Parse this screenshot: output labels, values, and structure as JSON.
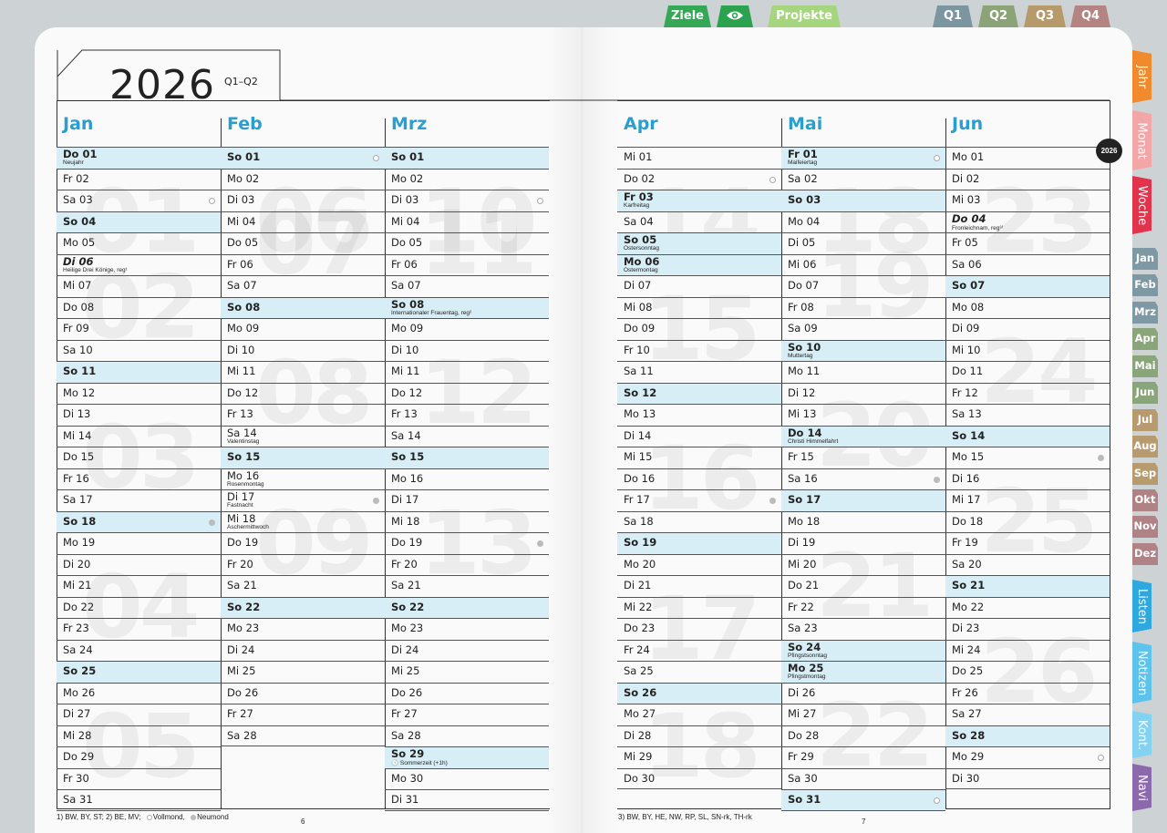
{
  "top_tabs": [
    {
      "label": "Ziele",
      "color": "#35a855"
    },
    {
      "label": "",
      "icon": "eye-icon",
      "color": "#2aa24e"
    },
    {
      "label": "Projekte",
      "color": "#a5d57c"
    },
    {
      "label": "Q1",
      "color": "#7b96a0"
    },
    {
      "label": "Q2",
      "color": "#8ba376"
    },
    {
      "label": "Q3",
      "color": "#b69a6a"
    },
    {
      "label": "Q4",
      "color": "#b38482"
    }
  ],
  "side_tabs": [
    {
      "label": "Jahr",
      "color": "#f08a2d"
    },
    {
      "label": "Monat",
      "color": "#f2a6a8"
    },
    {
      "label": "Woche",
      "color": "#e2334d"
    }
  ],
  "month_tabs": [
    {
      "label": "Jan",
      "color": "#7e98a4"
    },
    {
      "label": "Feb",
      "color": "#7e98a4"
    },
    {
      "label": "Mrz",
      "color": "#7e98a4"
    },
    {
      "label": "Apr",
      "color": "#8ba57a"
    },
    {
      "label": "Mai",
      "color": "#8ba57a"
    },
    {
      "label": "Jun",
      "color": "#8ba57a"
    },
    {
      "label": "Jul",
      "color": "#b79a6d"
    },
    {
      "label": "Aug",
      "color": "#b79a6d"
    },
    {
      "label": "Sep",
      "color": "#b79a6d"
    },
    {
      "label": "Okt",
      "color": "#b18285"
    },
    {
      "label": "Nov",
      "color": "#b18285"
    },
    {
      "label": "Dez",
      "color": "#b18285"
    }
  ],
  "bottom_tabs": [
    {
      "label": "Listen",
      "color": "#2ea8de"
    },
    {
      "label": "Notizen",
      "color": "#5ec3ec"
    },
    {
      "label": "Kont.",
      "color": "#83d2f2"
    },
    {
      "label": "Navi",
      "color": "#8c68ad"
    }
  ],
  "header": {
    "year": "2026",
    "quarter": "Q1–Q2",
    "badge": "2026"
  },
  "colors": {
    "month_heading": "#2a9fcf",
    "sunday_row": "#d8eef6"
  },
  "months": [
    {
      "name": "Jan",
      "weeks": [
        "01",
        "02",
        "03",
        "04",
        "05"
      ],
      "days": [
        {
          "t": "Do 01",
          "s": 1,
          "n": "Neujahr"
        },
        {
          "t": "Fr 02"
        },
        {
          "t": "Sa 03",
          "m": "full"
        },
        {
          "t": "So 04",
          "s": 1
        },
        {
          "t": "Mo 05"
        },
        {
          "t": "Di 06",
          "i": 1,
          "n": "Heilige Drei Könige, reg¹"
        },
        {
          "t": "Mi 07"
        },
        {
          "t": "Do 08"
        },
        {
          "t": "Fr 09"
        },
        {
          "t": "Sa 10"
        },
        {
          "t": "So 11",
          "s": 1
        },
        {
          "t": "Mo 12"
        },
        {
          "t": "Di 13"
        },
        {
          "t": "Mi 14"
        },
        {
          "t": "Do 15"
        },
        {
          "t": "Fr 16"
        },
        {
          "t": "Sa 17"
        },
        {
          "t": "So 18",
          "s": 1,
          "m": "new"
        },
        {
          "t": "Mo 19"
        },
        {
          "t": "Di 20"
        },
        {
          "t": "Mi 21"
        },
        {
          "t": "Do 22"
        },
        {
          "t": "Fr 23"
        },
        {
          "t": "Sa 24"
        },
        {
          "t": "So 25",
          "s": 1
        },
        {
          "t": "Mo 26"
        },
        {
          "t": "Di 27"
        },
        {
          "t": "Mi 28"
        },
        {
          "t": "Do 29"
        },
        {
          "t": "Fr 30"
        },
        {
          "t": "Sa 31"
        }
      ]
    },
    {
      "name": "Feb",
      "weeks": [
        "06",
        "07",
        "08",
        "09"
      ],
      "days": [
        {
          "t": "So 01",
          "s": 1,
          "m": "full"
        },
        {
          "t": "Mo 02"
        },
        {
          "t": "Di 03"
        },
        {
          "t": "Mi 04"
        },
        {
          "t": "Do 05"
        },
        {
          "t": "Fr 06"
        },
        {
          "t": "Sa 07"
        },
        {
          "t": "So 08",
          "s": 1
        },
        {
          "t": "Mo 09"
        },
        {
          "t": "Di 10"
        },
        {
          "t": "Mi 11"
        },
        {
          "t": "Do 12"
        },
        {
          "t": "Fr 13"
        },
        {
          "t": "Sa 14",
          "n": "Valentinstag"
        },
        {
          "t": "So 15",
          "s": 1
        },
        {
          "t": "Mo 16",
          "n": "Rosenmontag"
        },
        {
          "t": "Di 17",
          "n": "Fastnacht",
          "m": "new"
        },
        {
          "t": "Mi 18",
          "n": "Aschermittwoch"
        },
        {
          "t": "Do 19"
        },
        {
          "t": "Fr 20"
        },
        {
          "t": "Sa 21"
        },
        {
          "t": "So 22",
          "s": 1
        },
        {
          "t": "Mo 23"
        },
        {
          "t": "Di 24"
        },
        {
          "t": "Mi 25"
        },
        {
          "t": "Do 26"
        },
        {
          "t": "Fr 27"
        },
        {
          "t": "Sa 28"
        }
      ]
    },
    {
      "name": "Mrz",
      "weeks": [
        "10",
        "11",
        "12",
        "13"
      ],
      "days": [
        {
          "t": "So 01",
          "s": 1
        },
        {
          "t": "Mo 02"
        },
        {
          "t": "Di 03",
          "m": "full"
        },
        {
          "t": "Mi 04"
        },
        {
          "t": "Do 05"
        },
        {
          "t": "Fr 06"
        },
        {
          "t": "Sa 07"
        },
        {
          "t": "So 08",
          "s": 1,
          "n": "Internationaler Frauentag, reg²"
        },
        {
          "t": "Mo 09"
        },
        {
          "t": "Di 10"
        },
        {
          "t": "Mi 11"
        },
        {
          "t": "Do 12"
        },
        {
          "t": "Fr 13"
        },
        {
          "t": "Sa 14"
        },
        {
          "t": "So 15",
          "s": 1
        },
        {
          "t": "Mo 16"
        },
        {
          "t": "Di 17"
        },
        {
          "t": "Mi 18"
        },
        {
          "t": "Do 19",
          "m": "new"
        },
        {
          "t": "Fr 20"
        },
        {
          "t": "Sa 21"
        },
        {
          "t": "So 22",
          "s": 1
        },
        {
          "t": "Mo 23"
        },
        {
          "t": "Di 24"
        },
        {
          "t": "Mi 25"
        },
        {
          "t": "Do 26"
        },
        {
          "t": "Fr 27"
        },
        {
          "t": "Sa 28"
        },
        {
          "t": "So 29",
          "s": 1,
          "n": "🕓 Sommerzeit (+1h)"
        },
        {
          "t": "Mo 30"
        },
        {
          "t": "Di 31"
        }
      ]
    },
    {
      "name": "Apr",
      "weeks": [
        "14",
        "15",
        "16",
        "17",
        "18"
      ],
      "days": [
        {
          "t": "Mi 01"
        },
        {
          "t": "Do 02",
          "m": "full"
        },
        {
          "t": "Fr 03",
          "s": 1,
          "n": "Karfreitag"
        },
        {
          "t": "Sa 04"
        },
        {
          "t": "So 05",
          "s": 1,
          "n": "Ostersonntag"
        },
        {
          "t": "Mo 06",
          "s": 1,
          "n": "Ostermontag"
        },
        {
          "t": "Di 07"
        },
        {
          "t": "Mi 08"
        },
        {
          "t": "Do 09"
        },
        {
          "t": "Fr 10"
        },
        {
          "t": "Sa 11"
        },
        {
          "t": "So 12",
          "s": 1
        },
        {
          "t": "Mo 13"
        },
        {
          "t": "Di 14"
        },
        {
          "t": "Mi 15"
        },
        {
          "t": "Do 16"
        },
        {
          "t": "Fr 17",
          "m": "new"
        },
        {
          "t": "Sa 18"
        },
        {
          "t": "So 19",
          "s": 1
        },
        {
          "t": "Mo 20"
        },
        {
          "t": "Di 21"
        },
        {
          "t": "Mi 22"
        },
        {
          "t": "Do 23"
        },
        {
          "t": "Fr 24"
        },
        {
          "t": "Sa 25"
        },
        {
          "t": "So 26",
          "s": 1
        },
        {
          "t": "Mo 27"
        },
        {
          "t": "Di 28"
        },
        {
          "t": "Mi 29"
        },
        {
          "t": "Do 30"
        }
      ]
    },
    {
      "name": "Mai",
      "weeks": [
        "18",
        "19",
        "20",
        "21",
        "22"
      ],
      "days": [
        {
          "t": "Fr 01",
          "s": 1,
          "n": "Maifeiertag",
          "m": "full"
        },
        {
          "t": "Sa 02"
        },
        {
          "t": "So 03",
          "s": 1
        },
        {
          "t": "Mo 04"
        },
        {
          "t": "Di 05"
        },
        {
          "t": "Mi 06"
        },
        {
          "t": "Do 07"
        },
        {
          "t": "Fr 08"
        },
        {
          "t": "Sa 09"
        },
        {
          "t": "So 10",
          "s": 1,
          "n": "Muttertag"
        },
        {
          "t": "Mo 11"
        },
        {
          "t": "Di 12"
        },
        {
          "t": "Mi 13"
        },
        {
          "t": "Do 14",
          "s": 1,
          "n": "Christi Himmelfahrt"
        },
        {
          "t": "Fr 15"
        },
        {
          "t": "Sa 16",
          "m": "new"
        },
        {
          "t": "So 17",
          "s": 1
        },
        {
          "t": "Mo 18"
        },
        {
          "t": "Di 19"
        },
        {
          "t": "Mi 20"
        },
        {
          "t": "Do 21"
        },
        {
          "t": "Fr 22"
        },
        {
          "t": "Sa 23"
        },
        {
          "t": "So 24",
          "s": 1,
          "n": "Pfingstsonntag"
        },
        {
          "t": "Mo 25",
          "s": 1,
          "n": "Pfingstmontag"
        },
        {
          "t": "Di 26"
        },
        {
          "t": "Mi 27"
        },
        {
          "t": "Do 28"
        },
        {
          "t": "Fr 29"
        },
        {
          "t": "Sa 30"
        },
        {
          "t": "So 31",
          "s": 1,
          "m": "full"
        }
      ]
    },
    {
      "name": "Jun",
      "weeks": [
        "23",
        "24",
        "25",
        "26"
      ],
      "days": [
        {
          "t": "Mo 01"
        },
        {
          "t": "Di 02"
        },
        {
          "t": "Mi 03"
        },
        {
          "t": "Do 04",
          "i": 1,
          "n": "Fronleichnam, reg³⁾"
        },
        {
          "t": "Fr 05"
        },
        {
          "t": "Sa 06"
        },
        {
          "t": "So 07",
          "s": 1
        },
        {
          "t": "Mo 08"
        },
        {
          "t": "Di 09"
        },
        {
          "t": "Mi 10"
        },
        {
          "t": "Do 11"
        },
        {
          "t": "Fr 12"
        },
        {
          "t": "Sa 13"
        },
        {
          "t": "So 14",
          "s": 1
        },
        {
          "t": "Mo 15",
          "m": "new"
        },
        {
          "t": "Di 16"
        },
        {
          "t": "Mi 17"
        },
        {
          "t": "Do 18"
        },
        {
          "t": "Fr 19"
        },
        {
          "t": "Sa 20"
        },
        {
          "t": "So 21",
          "s": 1
        },
        {
          "t": "Mo 22"
        },
        {
          "t": "Di 23"
        },
        {
          "t": "Mi 24"
        },
        {
          "t": "Do 25"
        },
        {
          "t": "Fr 26"
        },
        {
          "t": "Sa 27"
        },
        {
          "t": "So 28",
          "s": 1
        },
        {
          "t": "Mo 29",
          "m": "full"
        },
        {
          "t": "Di 30"
        }
      ]
    }
  ],
  "footer": {
    "left_regions": "1) BW, BY, ST;    2) BE, MV;",
    "full_moon": "Vollmond,",
    "new_moon": "Neumond",
    "right_regions": "3) BW, BY, HE, NW, RP, SL, SN-rk, TH-rk",
    "page_left": "6",
    "page_right": "7"
  }
}
